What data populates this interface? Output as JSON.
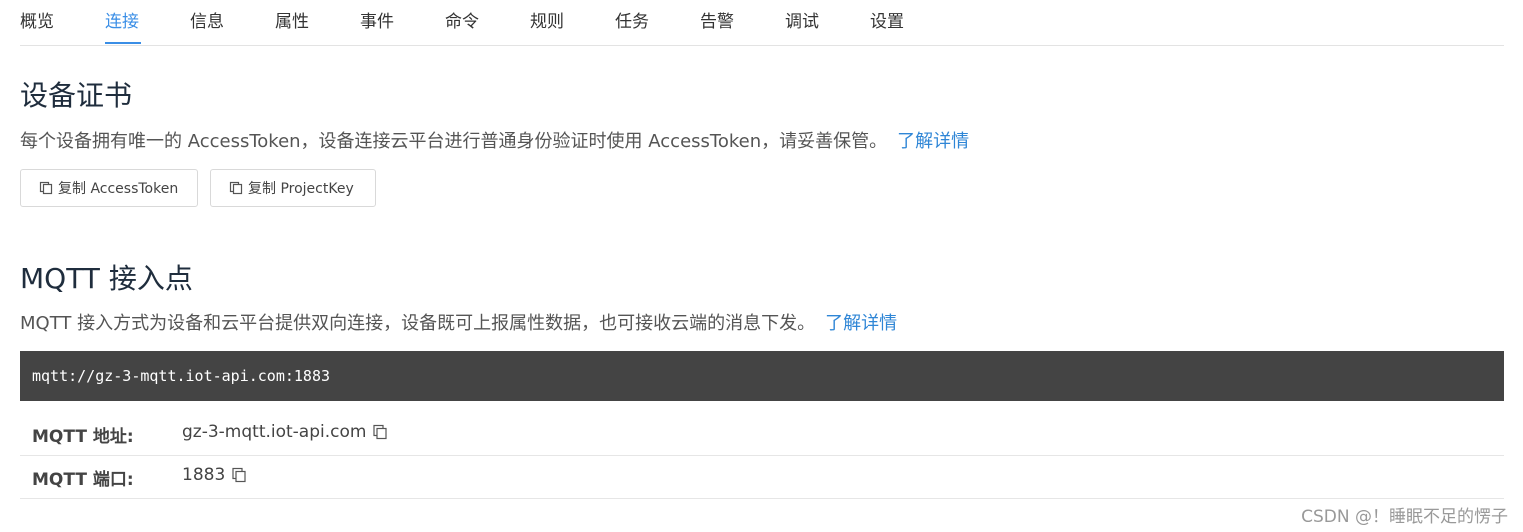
{
  "tabs": [
    {
      "label": "概览"
    },
    {
      "label": "连接"
    },
    {
      "label": "信息"
    },
    {
      "label": "属性"
    },
    {
      "label": "事件"
    },
    {
      "label": "命令"
    },
    {
      "label": "规则"
    },
    {
      "label": "任务"
    },
    {
      "label": "告警"
    },
    {
      "label": "调试"
    },
    {
      "label": "设置"
    }
  ],
  "active_tab": "连接",
  "certificate": {
    "title": "设备证书",
    "description": "每个设备拥有唯一的 AccessToken，设备连接云平台进行普通身份验证时使用 AccessToken，请妥善保管。",
    "learn_more": "了解详情",
    "copy_access_token_label": "复制 AccessToken",
    "copy_project_key_label": "复制 ProjectKey"
  },
  "mqtt": {
    "title": "MQTT 接入点",
    "description": "MQTT 接入方式为设备和云平台提供双向连接，设备既可上报属性数据，也可接收云端的消息下发。",
    "learn_more": "了解详情",
    "endpoint": "mqtt://gz-3-mqtt.iot-api.com:1883",
    "address_label": "MQTT 地址:",
    "address_value": "gz-3-mqtt.iot-api.com",
    "port_label": "MQTT 端口:",
    "port_value": "1883"
  },
  "watermark": "CSDN @！睡眠不足的愣子",
  "colors": {
    "accent": "#3a8ee6",
    "link": "#2f86d6",
    "code_background": "#444444"
  },
  "icons": {
    "copy": "copy-icon"
  }
}
